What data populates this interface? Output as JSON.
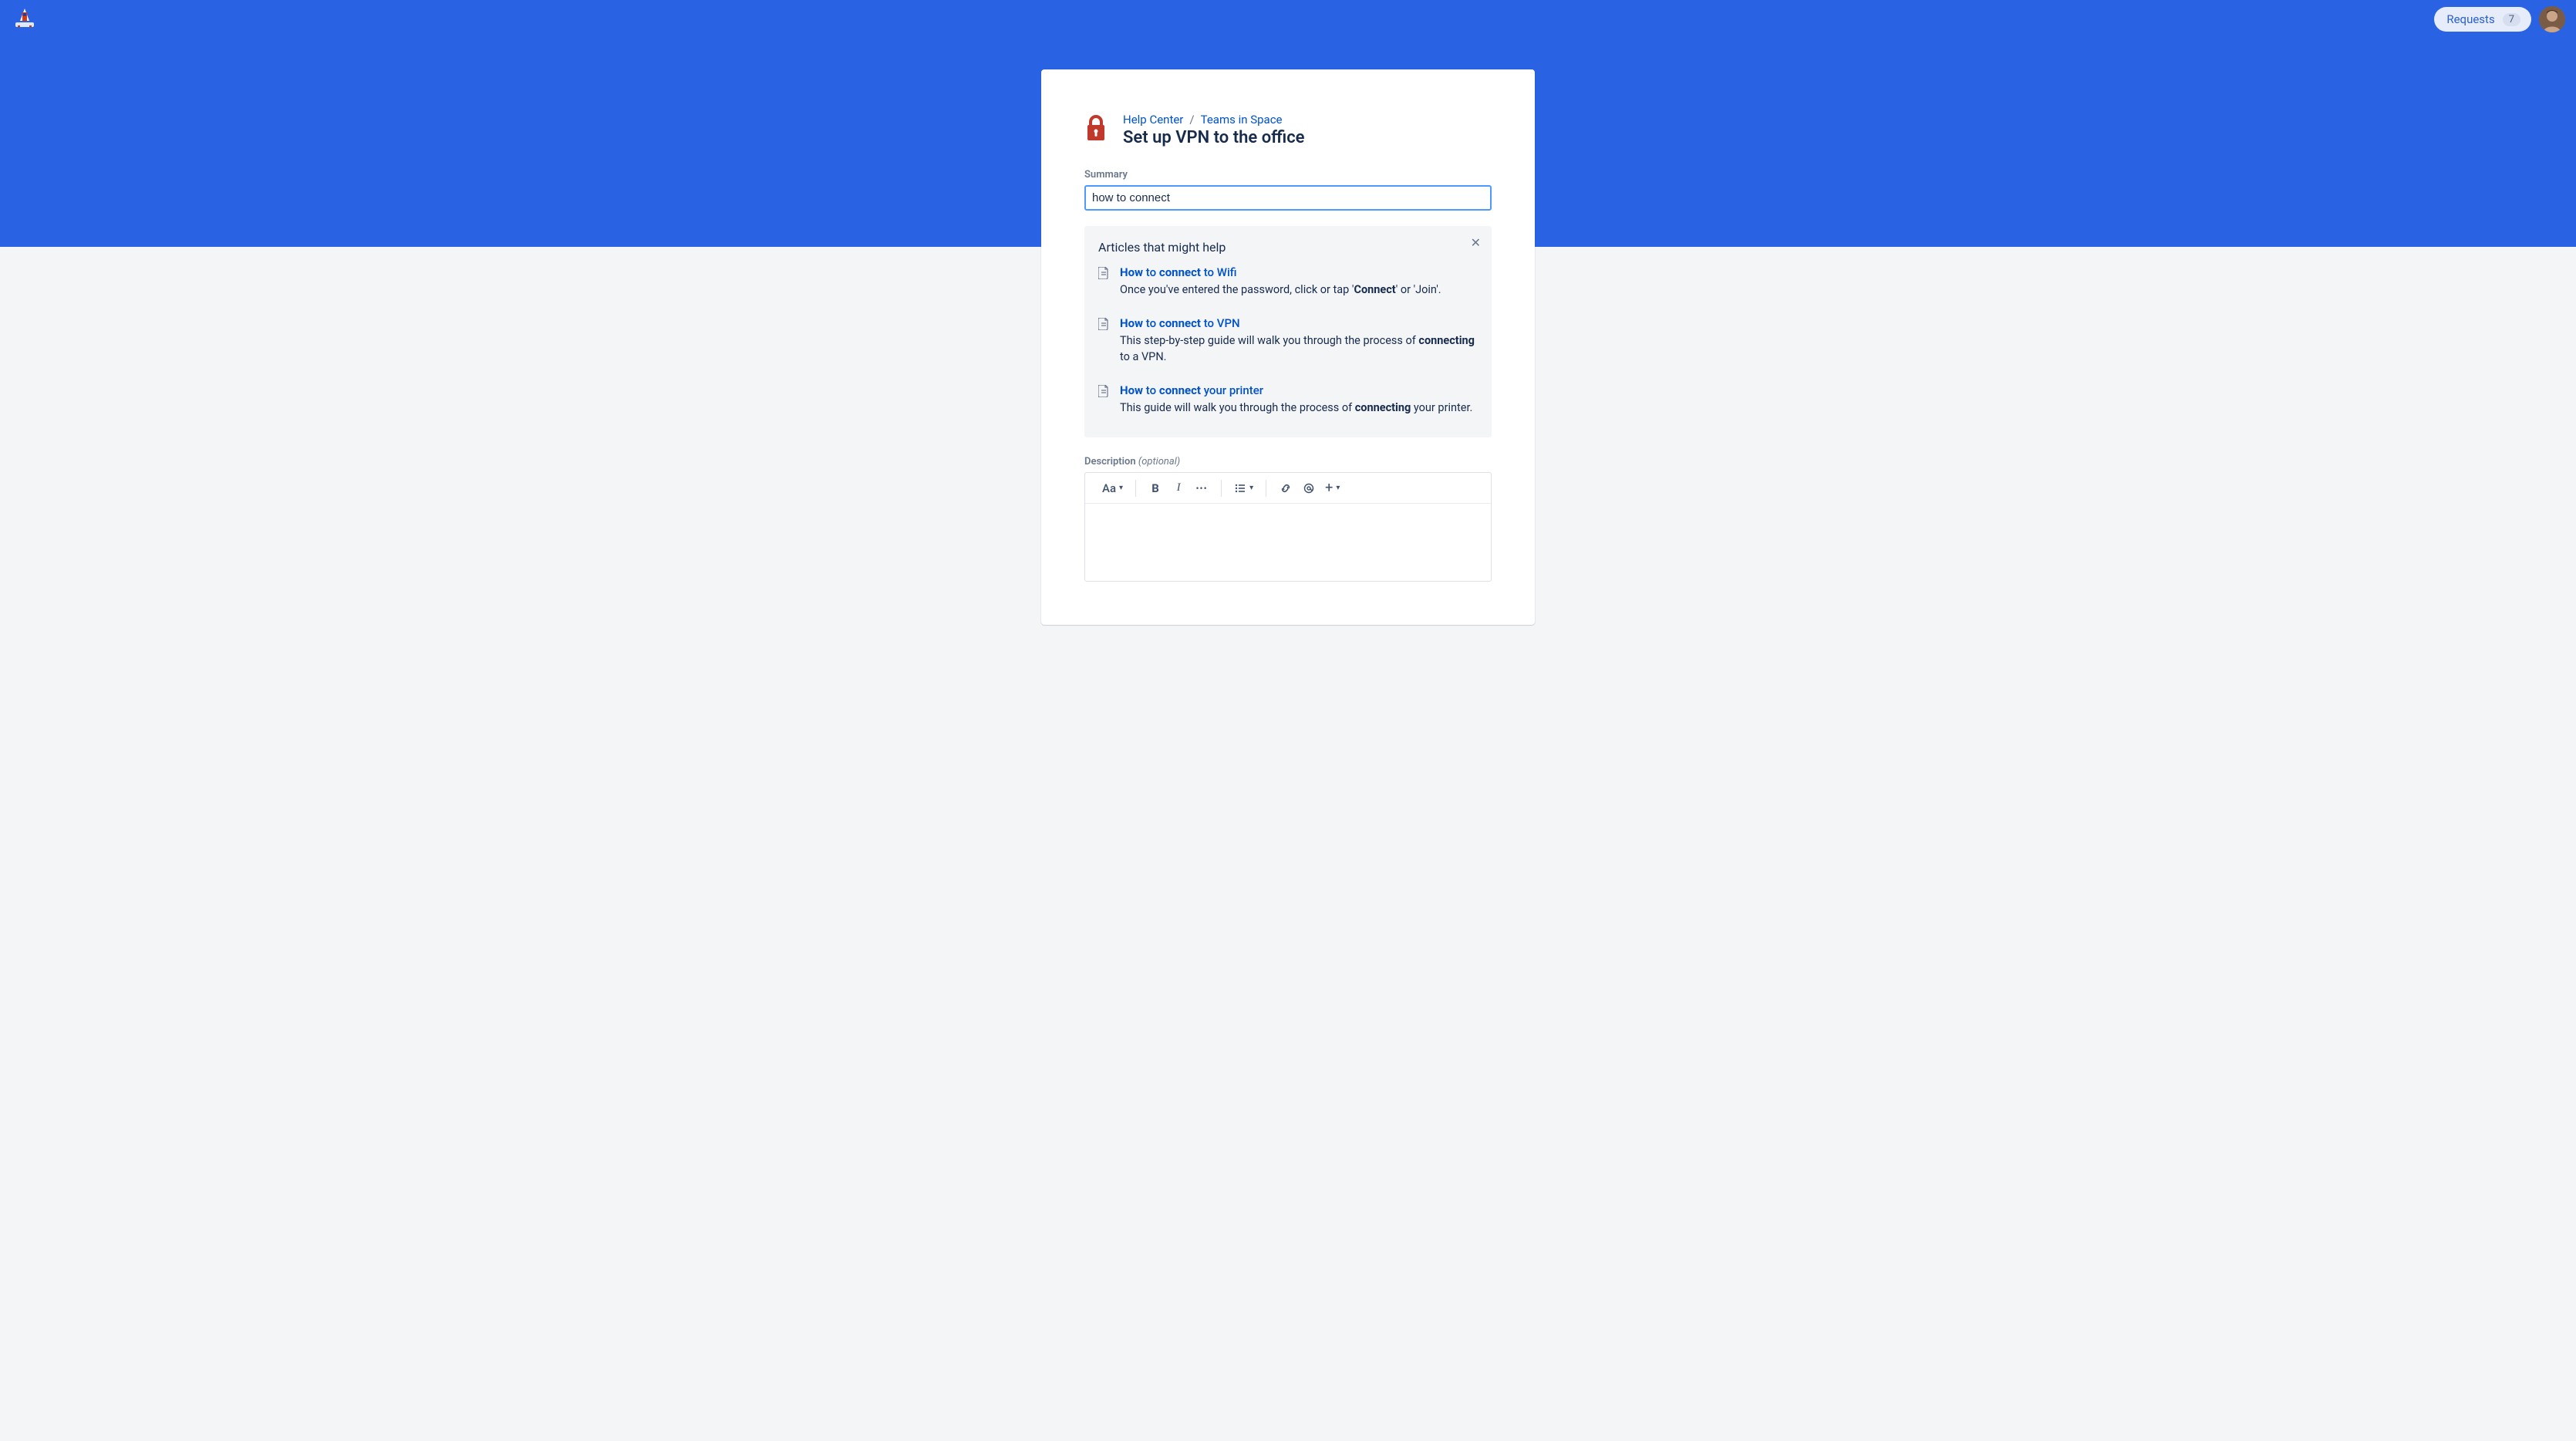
{
  "topbar": {
    "requests_label": "Requests",
    "requests_count": "7"
  },
  "breadcrumb": {
    "items": [
      "Help Center",
      "Teams in Space"
    ],
    "sep": "/"
  },
  "page": {
    "title": "Set up VPN to the office"
  },
  "summary": {
    "label": "Summary",
    "value": "how to connect"
  },
  "help_panel": {
    "title": "Articles that might help",
    "articles": [
      {
        "title_html": "<b>How</b> to <b>connect</b> to Wifi",
        "snippet_html": "Once you've entered the password, click or tap '<b>Connect</b>' or 'Join'."
      },
      {
        "title_html": "<b>How</b> to <b>connect</b> to VPN",
        "snippet_html": "This step-by-step guide will walk you through the process of <b>connecting</b> to a VPN."
      },
      {
        "title_html": "<b>How</b> to <b>connect</b> your printer",
        "snippet_html": "This guide will walk you through the process of <b>connecting</b> your printer."
      }
    ]
  },
  "description": {
    "label": "Description",
    "optional": "(optional)"
  },
  "toolbar": {
    "text_styles": "Aa",
    "bold": "B",
    "italic": "I",
    "more": "•••",
    "plus": "+"
  }
}
